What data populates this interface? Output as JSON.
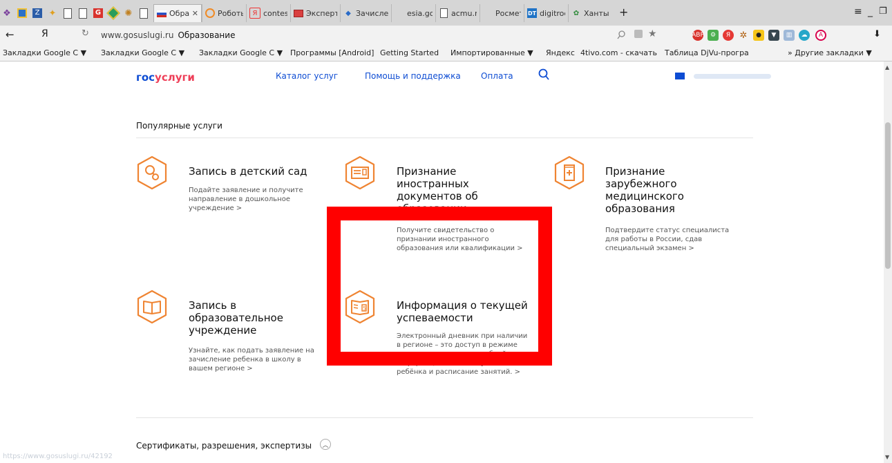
{
  "browser": {
    "tabs": [
      {
        "label": "Обра:",
        "icon": "russia-flag-icon",
        "active": true
      },
      {
        "label": "Роботы,",
        "icon": "orange-circle-icon"
      },
      {
        "label": "contest.y",
        "icon": "yandex-icon"
      },
      {
        "label": "Эксперт",
        "icon": "book-icon"
      },
      {
        "label": "Зачисле",
        "icon": "arrows-icon"
      },
      {
        "label": "esia.gosu",
        "icon": "blank-icon"
      },
      {
        "label": "acmu.ru",
        "icon": "page-icon"
      },
      {
        "label": "Росметод",
        "icon": "blank-icon"
      },
      {
        "label": "digitrode",
        "icon": "dt-icon"
      },
      {
        "label": "Ханты-М",
        "icon": "emblem-icon"
      }
    ],
    "new_tab": "+",
    "url_host": "www.gosuslugi.ru",
    "url_title": "Образование",
    "back_glyph": "←",
    "yandex_glyph": "Я",
    "reload_glyph": "↻",
    "download_glyph": "⬇",
    "bookmarks": [
      "Закладки Google С ▼",
      "Закладки Google С ▼",
      "Закладки Google С ▼",
      "Программы [Android]",
      "Getting Started",
      "Импортированные ▼",
      "Яндекс",
      "4tivo.com - скачать",
      "Таблица DjVu-програ"
    ],
    "more_bookmarks": "»  Другие закладки ▼"
  },
  "site": {
    "logo_part1": "гос",
    "logo_part2": "услуги",
    "nav": [
      "Каталог услуг",
      "Помощь и поддержка",
      "Оплата"
    ]
  },
  "section": {
    "title": "Популярные услуги",
    "bottom_title": "Сертификаты, разрешения, экспертизы"
  },
  "services": [
    {
      "title": "Запись в детский сад",
      "desc": "Подайте заявление и получите направление в дошкольное учреждение  >"
    },
    {
      "title": "Признание иностранных документов об образовании",
      "desc": "Получите свидетельство о признании иностранного образования или квалификации  >"
    },
    {
      "title": "Признание зарубежного медицинского образования",
      "desc": "Подтвердите статус специалиста для работы в России, сдав специальный экзамен  >"
    },
    {
      "title": "Запись в образовательное учреждение",
      "desc": "Узнайте, как подать заявление на зачисление ребенка в школу в вашем регионе  >"
    },
    {
      "title": "Информация о текущей успеваемости",
      "desc": "Электронный дневник при наличии в регионе – это доступ в режиме реального времени к учебной информации, включая успеваемость ребёнка и расписание занятий.  >"
    }
  ],
  "status_url": "https://www.gosuslugi.ru/42192",
  "colors": {
    "accent": "#0d4cd3",
    "icon_orange": "#ef8432",
    "highlight": "#ff0000"
  }
}
